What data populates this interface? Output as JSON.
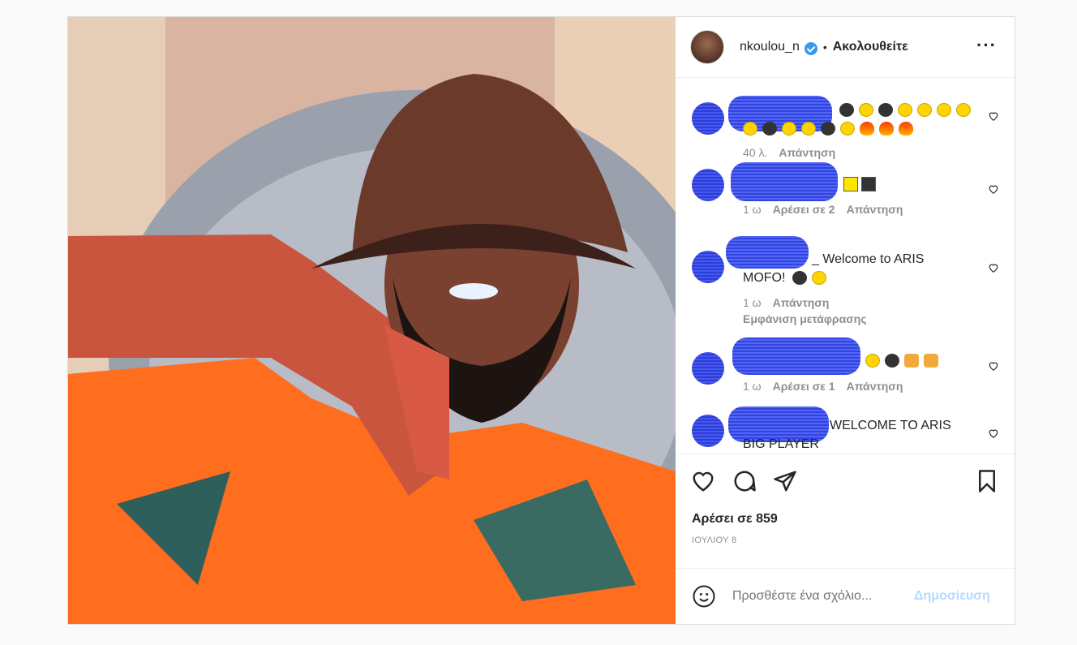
{
  "header": {
    "username": "nkoulou_n",
    "follow_status": "Ακολουθείτε",
    "more_icon": "more-dots-icon"
  },
  "comments": [
    {
      "time": "40 λ.",
      "likes": "",
      "reply": "Απάντηση"
    },
    {
      "time": "1 ω",
      "likes": "Αρέσει σε 2",
      "reply": "Απάντηση"
    },
    {
      "text": "_ Welcome to ARIS",
      "text2": "MOFO!",
      "time": "1 ω",
      "reply": "Απάντηση",
      "translate": "Εμφάνιση μετάφρασης"
    },
    {
      "time": "1 ω",
      "likes": "Αρέσει σε 1",
      "reply": "Απάντηση"
    },
    {
      "text": "WELCOME TO ARIS",
      "text2": "BIG PLAYER"
    }
  ],
  "likes_count": "Αρέσει σε 859",
  "date": "ΙΟΥΛΙΟΥ 8",
  "add_comment": {
    "placeholder": "Προσθέστε ένα σχόλιο...",
    "post_label": "Δημοσίευση"
  },
  "colors": {
    "accent": "#3897f0",
    "post_disabled": "#b3dbff",
    "muted": "#8e8e8e"
  }
}
